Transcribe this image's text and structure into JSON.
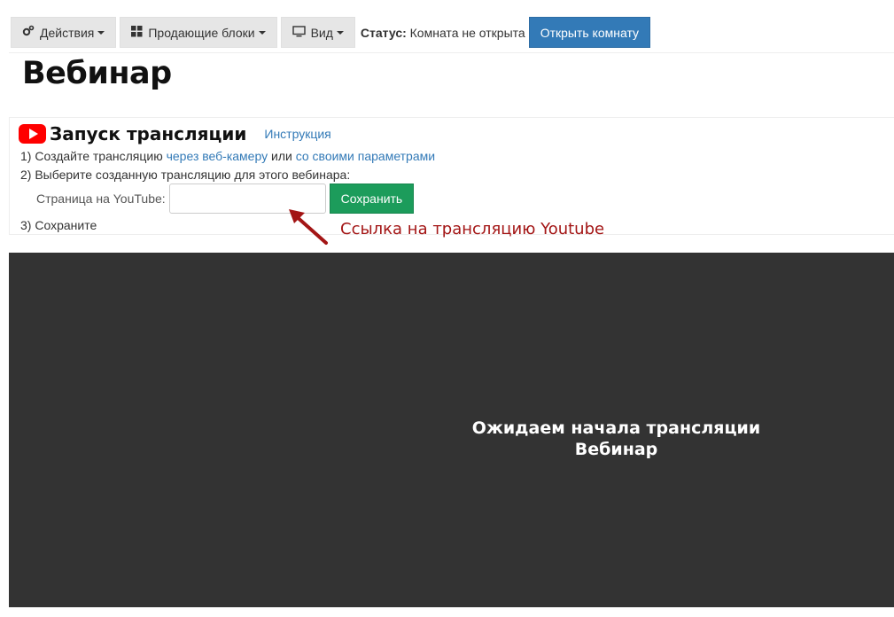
{
  "toolbar": {
    "actions_label": "Действия",
    "blocks_label": "Продающие блоки",
    "view_label": "Вид",
    "status_label": "Статус:",
    "status_value": "Комната не открыта",
    "open_room_label": "Открыть комнату",
    "icons": [
      "gears-icon",
      "grid-icon",
      "monitor-icon"
    ]
  },
  "page": {
    "title": "Вебинар"
  },
  "broadcast": {
    "title": "Запуск трансляции",
    "instruction_link": "Инструкция",
    "step1_prefix": "1) Создайте трансляцию",
    "step1_link1": "через веб-камеру",
    "step1_mid": "или",
    "step1_link2": "со своими параметрами",
    "step2": "2) Выберите созданную трансляцию для этого вебинара:",
    "youtube_label": "Страница на YouTube:",
    "youtube_value": "",
    "save_label": "Сохранить",
    "step3": "3) Сохраните"
  },
  "annotation": {
    "text": "Ссылка на трансляцию Youtube",
    "color": "#a31515"
  },
  "video": {
    "line1": "Ожидаем начала трансляции",
    "line2": "Вебинар"
  },
  "colors": {
    "primary": "#337ab7",
    "success": "#1c9c5b",
    "youtube": "#ff0000",
    "video_bg": "#333333"
  }
}
